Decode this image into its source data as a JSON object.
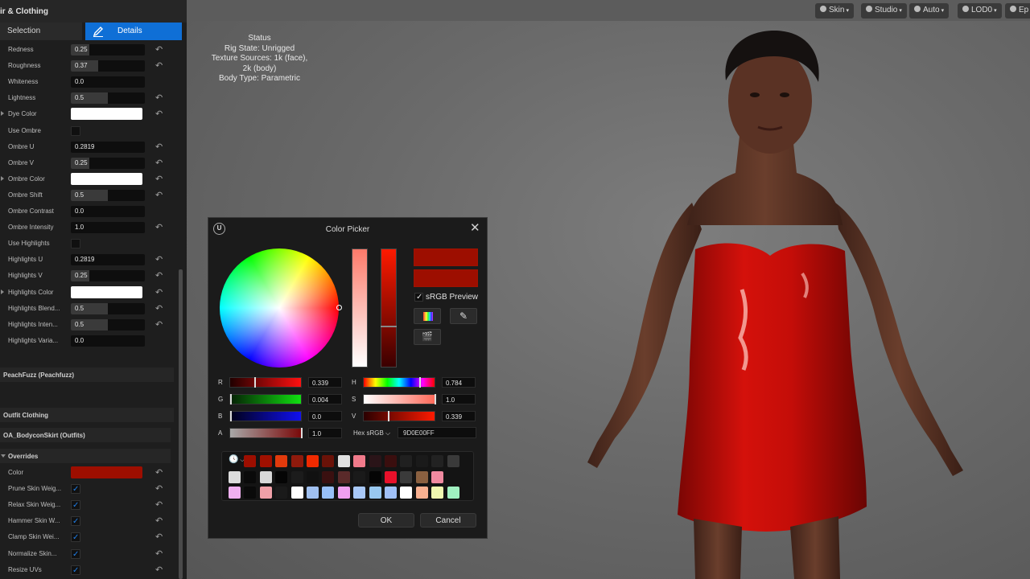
{
  "panel": {
    "title": "ir & Clothing",
    "tabs": {
      "selection": "Selection",
      "details": "Details"
    }
  },
  "hair_properties": [
    {
      "label": "Redness",
      "type": "slider",
      "value": "0.25",
      "fraction": 0.25,
      "reset": true
    },
    {
      "label": "Roughness",
      "type": "slider",
      "value": "0.37",
      "fraction": 0.37,
      "reset": true
    },
    {
      "label": "Whiteness",
      "type": "field",
      "value": "0.0",
      "reset": false
    },
    {
      "label": "Lightness",
      "type": "slider",
      "value": "0.5",
      "fraction": 0.5,
      "reset": true
    },
    {
      "label": "Dye Color",
      "type": "color",
      "color": "#ffffff",
      "reset": true,
      "expander": true
    },
    {
      "label": "Use Ombre",
      "type": "check",
      "checked": false,
      "reset": false
    },
    {
      "label": "Ombre U",
      "type": "field",
      "value": "0.2819",
      "reset": true
    },
    {
      "label": "Ombre V",
      "type": "slider",
      "value": "0.25",
      "fraction": 0.25,
      "reset": true
    },
    {
      "label": "Ombre Color",
      "type": "color",
      "color": "#ffffff",
      "reset": true,
      "expander": true
    },
    {
      "label": "Ombre Shift",
      "type": "slider",
      "value": "0.5",
      "fraction": 0.5,
      "reset": true
    },
    {
      "label": "Ombre Contrast",
      "type": "field",
      "value": "0.0",
      "reset": false
    },
    {
      "label": "Ombre Intensity",
      "type": "field",
      "value": "1.0",
      "reset": true
    },
    {
      "label": "Use Highlights",
      "type": "check",
      "checked": false,
      "reset": false
    },
    {
      "label": "Highlights U",
      "type": "field",
      "value": "0.2819",
      "reset": true
    },
    {
      "label": "Highlights V",
      "type": "slider",
      "value": "0.25",
      "fraction": 0.25,
      "reset": true
    },
    {
      "label": "Highlights Color",
      "type": "color",
      "color": "#ffffff",
      "reset": true,
      "expander": true
    },
    {
      "label": "Highlights Blend...",
      "type": "slider",
      "value": "0.5",
      "fraction": 0.5,
      "reset": true
    },
    {
      "label": "Highlights Inten...",
      "type": "slider",
      "value": "0.5",
      "fraction": 0.5,
      "reset": true
    },
    {
      "label": "Highlights Varia...",
      "type": "field",
      "value": "0.0",
      "reset": false
    }
  ],
  "sections": {
    "peachfuzz": "PeachFuzz (Peachfuzz)",
    "outfit": "Outfit Clothing",
    "outfit_item": "OA_BodyconSkirt (Outfits)",
    "overrides": "Overrides"
  },
  "override_properties": [
    {
      "label": "Color",
      "type": "color",
      "color": "#9d0e00",
      "reset": true
    },
    {
      "label": "Prune Skin Weig...",
      "type": "check",
      "checked": true,
      "reset": true
    },
    {
      "label": "Relax Skin Weig...",
      "type": "check",
      "checked": true,
      "reset": true
    },
    {
      "label": "Hammer Skin W...",
      "type": "check",
      "checked": true,
      "reset": true
    },
    {
      "label": "Clamp Skin Wei...",
      "type": "check",
      "checked": true,
      "reset": true
    },
    {
      "label": "Normalize Skin...",
      "type": "check",
      "checked": true,
      "reset": true
    },
    {
      "label": "Resize UVs",
      "type": "check",
      "checked": true,
      "reset": true
    }
  ],
  "viewport": {
    "toolbar": [
      {
        "label": "Skin",
        "icon": "skin-icon"
      },
      {
        "label": "Studio",
        "icon": "lighting-icon"
      },
      {
        "label": "Auto",
        "icon": "auto-icon"
      },
      {
        "label": "LOD0",
        "icon": "lod-icon"
      },
      {
        "label": "Ep",
        "icon": "epic-icon"
      }
    ],
    "status": {
      "heading": "Status",
      "rig_state": "Rig State: Unrigged",
      "texture_sources": "Texture Sources: 1k (face), 2k (body)",
      "body_type": "Body Type: Parametric"
    }
  },
  "color_picker": {
    "title": "Color Picker",
    "srgb_label": "sRGB Preview",
    "srgb_checked": true,
    "current_color": "#9d0e00",
    "old_color": "#9d0e00",
    "channels": {
      "r": {
        "label": "R",
        "value": "0.339",
        "fraction": 0.339
      },
      "g": {
        "label": "G",
        "value": "0.004",
        "fraction": 0.004
      },
      "b": {
        "label": "B",
        "value": "0.0",
        "fraction": 0.0
      },
      "a": {
        "label": "A",
        "value": "1.0",
        "fraction": 1.0
      },
      "h": {
        "label": "H",
        "value": "0.784",
        "fraction": 0.784
      },
      "s": {
        "label": "S",
        "value": "1.0",
        "fraction": 1.0
      },
      "v": {
        "label": "V",
        "value": "0.339",
        "fraction": 0.339
      }
    },
    "hex_label": "Hex sRGB",
    "hex_value": "9D0E00FF",
    "swatches": [
      [
        "#9d0e00",
        "#a01000",
        "#e23a0c",
        "#8f1a0c",
        "#f02a00",
        "#6a1208",
        "#e0e0e0",
        "#f07a8a",
        "#2a1418",
        "#3a0e0e",
        "#202020",
        "#1a1a1a",
        "#222222",
        "#3a3a3a"
      ],
      [
        "#dcdcdc",
        "#0a0a0a",
        "#d8d8d8",
        "#050505",
        "#1c1c1c",
        "#111111",
        "#3a1010",
        "#5a2a2a",
        "#1a1a1a",
        "#050505",
        "#e8102a",
        "#3a3a3a",
        "#8a6040",
        "#f08aa0"
      ],
      [
        "#f0b0f0",
        "#0a0a0a",
        "#f0a0a8",
        "#1a1a1a",
        "#ffffff",
        "#a0c0f0",
        "#98c0f8",
        "#f0a0f0",
        "#a8c8f8",
        "#98c8f0",
        "#a0c0f8",
        "#ffffff",
        "#f8b090",
        "#f0f8b0",
        "#a0f0c0"
      ]
    ],
    "ok_label": "OK",
    "cancel_label": "Cancel"
  },
  "colors": {
    "accent": "#0f6fd6",
    "dress": "#c80d08",
    "skin": "#5b3426"
  }
}
